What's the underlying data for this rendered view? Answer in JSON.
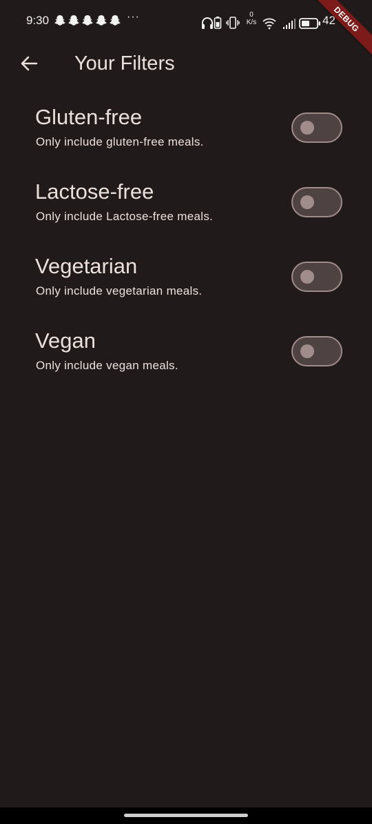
{
  "status_bar": {
    "time": "9:30",
    "notification_icons": [
      "snapchat-icon",
      "snapchat-icon",
      "snapchat-icon",
      "snapchat-icon",
      "snapchat-icon"
    ],
    "more_indicator": "···",
    "net_speed_value": "0",
    "net_speed_unit": "K/s",
    "battery_text": "42"
  },
  "debug_banner": "DEBUG",
  "app_bar": {
    "title": "Your Filters",
    "back_icon": "arrow-back-icon"
  },
  "filters": [
    {
      "title": "Gluten-free",
      "subtitle": "Only include gluten-free meals.",
      "enabled": false
    },
    {
      "title": "Lactose-free",
      "subtitle": "Only include Lactose-free meals.",
      "enabled": false
    },
    {
      "title": "Vegetarian",
      "subtitle": "Only include vegetarian meals.",
      "enabled": false
    },
    {
      "title": "Vegan",
      "subtitle": "Only include vegan meals.",
      "enabled": false
    }
  ],
  "colors": {
    "background": "#201b1a",
    "text": "#ece0dd",
    "switch_track": "#4e4342",
    "switch_outline": "#a08c8a",
    "debug_banner": "#7d1a1a"
  }
}
